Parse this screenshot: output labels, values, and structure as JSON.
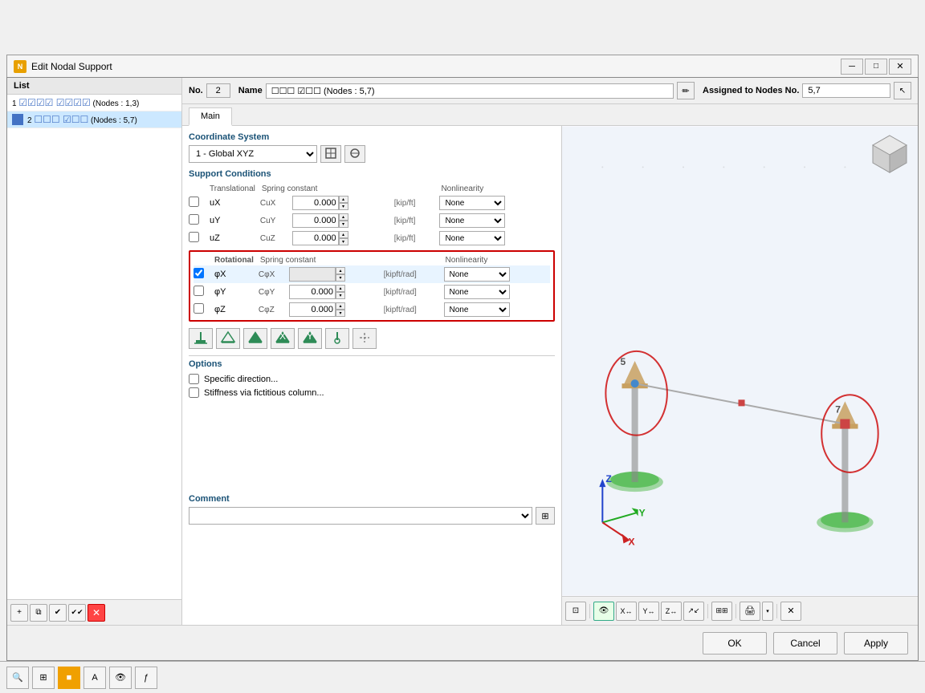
{
  "window": {
    "title": "Edit Nodal Support"
  },
  "list": {
    "header": "List",
    "items": [
      {
        "id": 1,
        "label": "1 ☑☑☑☑ ☑☑☑☑ (Nodes : 1,3)",
        "selected": false
      },
      {
        "id": 2,
        "label": "2 ☐☐☐ ☑☐☐ (Nodes : 5,7)",
        "selected": true
      }
    ]
  },
  "form": {
    "no_label": "No.",
    "no_value": "2",
    "name_label": "Name",
    "name_value": "☐☐☐ ☑☐☐ (Nodes : 5,7)",
    "assigned_label": "Assigned to Nodes No.",
    "assigned_value": "5,7",
    "tab_main": "Main",
    "coord_label": "Coordinate System",
    "coord_value": "1 - Global XYZ",
    "support_conditions_label": "Support Conditions",
    "translational_label": "Translational",
    "spring_constant_label": "Spring constant",
    "nonlinearity_label": "Nonlinearity",
    "ux_label": "uX",
    "ux_spring": "CuX",
    "ux_value": "0.000",
    "ux_unit": "[kip/ft]",
    "ux_nonlin": "None",
    "uy_label": "uY",
    "uy_spring": "CuY",
    "uy_value": "0.000",
    "uy_unit": "[kip/ft]",
    "uy_nonlin": "None",
    "uz_label": "uZ",
    "uz_spring": "CuZ",
    "uz_value": "0.000",
    "uz_unit": "[kip/ft]",
    "uz_nonlin": "None",
    "rotational_label": "Rotational",
    "rot_spring_label": "Spring constant",
    "rot_nonlin_label": "Nonlinearity",
    "phix_label": "φX",
    "phix_spring": "CφX",
    "phix_value": "",
    "phix_unit": "[kipft/rad]",
    "phix_nonlin": "None",
    "phix_checked": true,
    "phiy_label": "φY",
    "phiy_spring": "CφY",
    "phiy_value": "0.000",
    "phiy_unit": "[kipft/rad]",
    "phiy_nonlin": "None",
    "phiy_checked": false,
    "phiz_label": "φZ",
    "phiz_spring": "CφZ",
    "phiz_value": "0.000",
    "phiz_unit": "[kipft/rad]",
    "phiz_nonlin": "None",
    "phiz_checked": false,
    "options_label": "Options",
    "specific_direction_label": "Specific direction...",
    "stiffness_fictitious_label": "Stiffness via fictitious column...",
    "comment_label": "Comment"
  },
  "dialog_buttons": {
    "ok": "OK",
    "cancel": "Cancel",
    "apply": "Apply"
  },
  "view": {
    "node5_label": "5",
    "node7_label": "7"
  },
  "icons": {
    "pencil": "✏",
    "cursor": "↖",
    "folder_open": "📂",
    "check_all": "✔",
    "check_mark": "✓",
    "delete": "✕",
    "add": "+",
    "grid": "⊞",
    "eye": "👁",
    "print": "🖨",
    "zoom": "🔍",
    "arrow_up": "▲",
    "arrow_down": "▼",
    "arrow_up_small": "▴",
    "arrow_down_small": "▾"
  }
}
